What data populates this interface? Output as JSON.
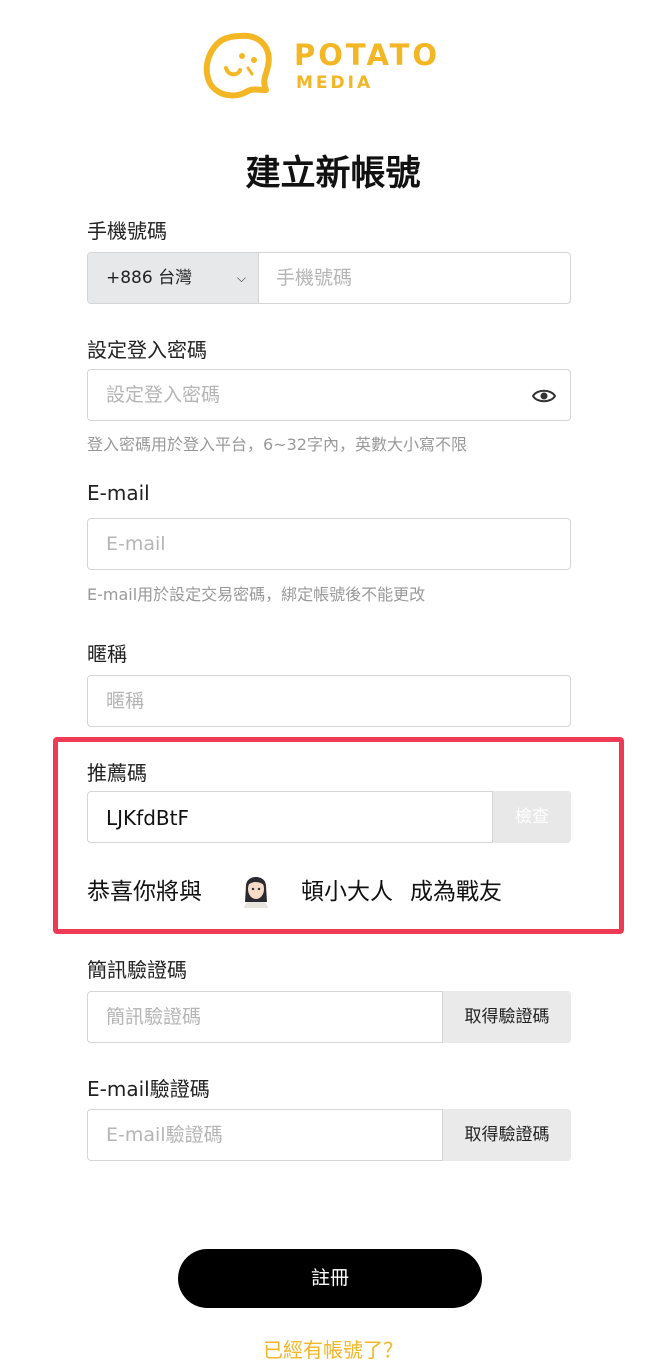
{
  "brand": {
    "name": "POTATO",
    "subname": "MEDIA",
    "color": "#f3b624"
  },
  "page_title": "建立新帳號",
  "phone": {
    "label": "手機號碼",
    "country_code": "+886 台灣",
    "placeholder": "手機號碼"
  },
  "password": {
    "label": "設定登入密碼",
    "placeholder": "設定登入密碼",
    "hint": "登入密碼用於登入平台，6~32字內，英數大小寫不限"
  },
  "email": {
    "label": "E-mail",
    "placeholder": "E-mail",
    "hint": "E-mail用於設定交易密碼，綁定帳號後不能更改"
  },
  "nickname": {
    "label": "暱稱",
    "placeholder": "暱稱"
  },
  "referral": {
    "label": "推薦碼",
    "value": "LJKfdBtF",
    "check_button": "檢查",
    "congrats_prefix": "恭喜你將與",
    "friend_name": "頓小大人",
    "congrats_suffix": "成為戰友"
  },
  "sms_code": {
    "label": "簡訊驗證碼",
    "placeholder": "簡訊驗證碼",
    "button": "取得驗證碼"
  },
  "email_code": {
    "label": "E-mail驗證碼",
    "placeholder": "E-mail驗證碼",
    "button": "取得驗證碼"
  },
  "register_button": "註冊",
  "login_link": "已經有帳號了？",
  "colors": {
    "highlight": "#ef3a55",
    "accent": "#f3b624"
  }
}
